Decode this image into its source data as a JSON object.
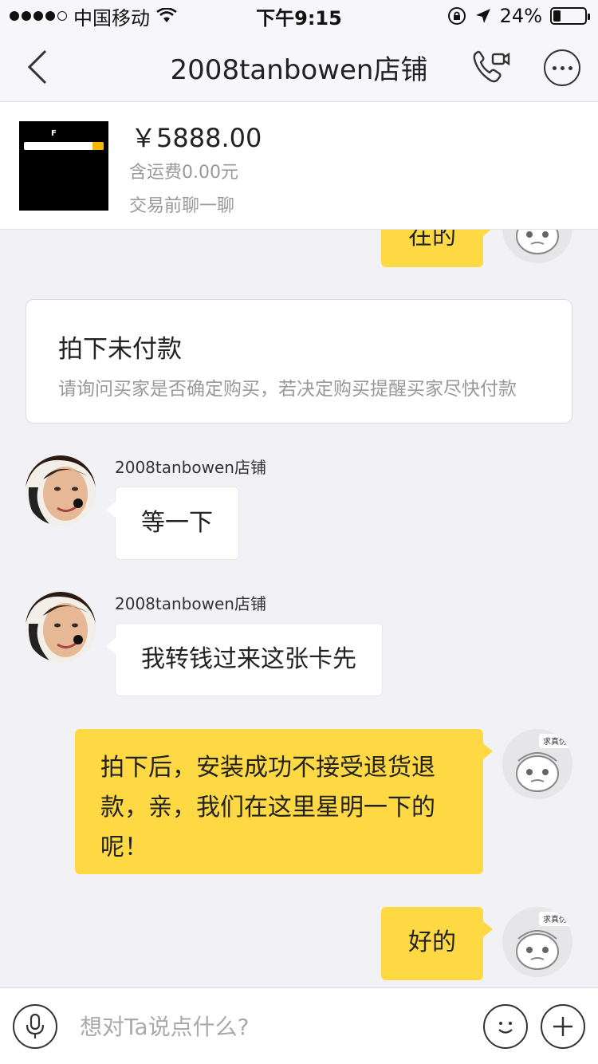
{
  "status_bar": {
    "carrier": "中国移动",
    "time": "下午9:15",
    "battery_percent": "24%",
    "battery_level": 0.24,
    "icons": [
      "signal-dots-icon",
      "wifi-icon",
      "orientation-lock-icon",
      "location-icon",
      "battery-icon"
    ]
  },
  "nav": {
    "title": "2008tanbowen店铺",
    "icons": [
      "back-chevron-icon",
      "video-call-icon",
      "more-icon"
    ]
  },
  "product": {
    "price": "￥5888.00",
    "shipping": "含运费0.00元",
    "hint": "交易前聊一聊",
    "thumb_logo": "F"
  },
  "chat": {
    "partial_message": "在的",
    "system_card": {
      "title": "拍下未付款",
      "desc": "请询问买家是否确定购买，若决定购买提醒买家尽快付款"
    },
    "messages": [
      {
        "direction": "in",
        "sender": "2008tanbowen店铺",
        "text": "等一下"
      },
      {
        "direction": "in",
        "sender": "2008tanbowen店铺",
        "text": "我转钱过来这张卡先"
      },
      {
        "direction": "out",
        "line1": "拍下后，安装成功不接受退货退",
        "line2": "款，亲，我们在这里星明一下的",
        "line3": "呢！"
      },
      {
        "direction": "out",
        "text": "好的"
      }
    ],
    "buyer_avatar_label": "求真伪"
  },
  "input_bar": {
    "placeholder": "想对Ta说点什么?",
    "icons": [
      "microphone-icon",
      "emoji-icon",
      "plus-icon"
    ]
  },
  "colors": {
    "accent_yellow": "#ffd944",
    "background": "#f2f2f6",
    "text_primary": "#222222",
    "text_secondary": "#999999"
  }
}
